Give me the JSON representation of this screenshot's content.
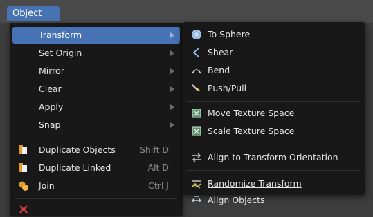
{
  "header": {
    "menu_label": "Object"
  },
  "object_menu": {
    "items": [
      {
        "label": "Transform"
      },
      {
        "label": "Set Origin"
      },
      {
        "label": "Mirror"
      },
      {
        "label": "Clear"
      },
      {
        "label": "Apply"
      },
      {
        "label": "Snap"
      },
      {
        "label": "Duplicate Objects",
        "shortcut": "Shift D",
        "icon": "duplicate-icon"
      },
      {
        "label": "Duplicate Linked",
        "shortcut": "Alt D",
        "icon": "duplicate-linked-icon"
      },
      {
        "label": "Join",
        "shortcut": "Ctrl J",
        "icon": "join-icon"
      }
    ]
  },
  "transform_submenu": {
    "items": [
      {
        "label": "To Sphere",
        "icon": "sphere-icon"
      },
      {
        "label": "Shear",
        "icon": "shear-icon"
      },
      {
        "label": "Bend",
        "icon": "bend-icon"
      },
      {
        "label": "Push/Pull",
        "icon": "push-pull-icon"
      },
      {
        "label": "Move Texture Space",
        "icon": "move-texture-space-icon"
      },
      {
        "label": "Scale Texture Space",
        "icon": "scale-texture-space-icon"
      },
      {
        "label": "Align to Transform Orientation",
        "icon": "align-orientation-icon"
      },
      {
        "label": "Randomize Transform",
        "icon": "randomize-icon"
      },
      {
        "label": "Align Objects",
        "icon": "align-objects-icon"
      }
    ]
  },
  "colors": {
    "highlight": "#4772b3",
    "menu_bg": "#181818",
    "topbar_bg": "#4a4a4a"
  }
}
